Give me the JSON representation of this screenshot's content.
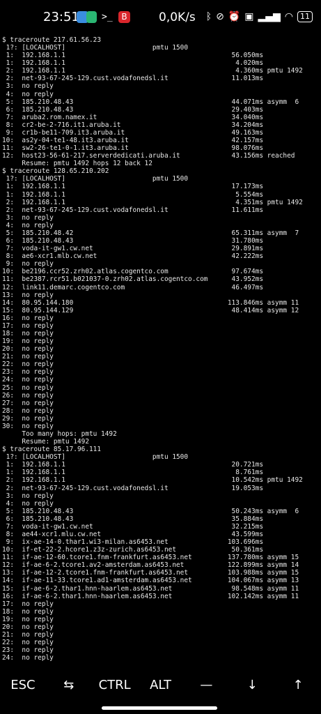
{
  "statusbar": {
    "time": "23:51",
    "net_speed": "0,0K/s",
    "battery": "11",
    "app_icons": [
      "messages-icon",
      "shield-app-icon",
      "terminal-icon",
      "bitwarden-icon"
    ],
    "system_icons": [
      "bluetooth-icon",
      "vibrate-off-icon",
      "alarm-icon",
      "nfc-icon",
      "signal-icon",
      "wifi-icon"
    ]
  },
  "terminal": {
    "lines": [
      "$ traceroute 217.61.56.23",
      " 1?: [LOCALHOST]                      pmtu 1500",
      " 1:  192.168.1.1                                          56.050ms",
      " 1:  192.168.1.1                                           4.020ms",
      " 2:  192.168.1.1                                           4.360ms pmtu 1492",
      " 2:  net-93-67-245-129.cust.vodafonedsl.it                11.013ms",
      " 3:  no reply",
      " 4:  no reply",
      " 5:  185.210.48.43                                        44.071ms asymm  6",
      " 6:  185.210.48.43                                        29.403ms",
      " 7:  aruba2.rom.namex.it                                  34.040ms",
      " 8:  cr2-be-2-716.it1.aruba.it                            34.204ms",
      " 9:  cr1b-be11-709.it3.aruba.it                           49.163ms",
      "10:  as2y-04-te1-48.it3.aruba.it                          42.157ms",
      "11:  sw2-26-te1-0-1.it3.aruba.it                          98.076ms",
      "12:  host23-56-61-217.serverdedicati.aruba.it             43.156ms reached",
      "     Resume: pmtu 1492 hops 12 back 12",
      "$ traceroute 128.65.210.202",
      " 1?: [LOCALHOST]                      pmtu 1500",
      " 1:  192.168.1.1                                          17.173ms",
      " 1:  192.168.1.1                                           5.554ms",
      " 2:  192.168.1.1                                           4.351ms pmtu 1492",
      " 2:  net-93-67-245-129.cust.vodafonedsl.it                11.611ms",
      " 3:  no reply",
      " 4:  no reply",
      " 5:  185.210.48.42                                        65.311ms asymm  7",
      " 6:  185.210.48.43                                        31.780ms",
      " 7:  voda-it-gw1.cw.net                                   29.891ms",
      " 8:  ae6-xcr1.mlb.cw.net                                  42.222ms",
      " 9:  no reply",
      "10:  be2196.ccr52.zrh02.atlas.cogentco.com                97.674ms",
      "11:  be2387.rcr51.b021037-0.zrh02.atlas.cogentco.com      43.952ms",
      "12:  link11.demarc.cogentco.com                           46.497ms",
      "13:  no reply",
      "14:  80.95.144.180                                       113.846ms asymm 11",
      "15:  80.95.144.129                                        48.414ms asymm 12",
      "16:  no reply",
      "17:  no reply",
      "18:  no reply",
      "19:  no reply",
      "20:  no reply",
      "21:  no reply",
      "22:  no reply",
      "23:  no reply",
      "24:  no reply",
      "25:  no reply",
      "26:  no reply",
      "27:  no reply",
      "28:  no reply",
      "29:  no reply",
      "30:  no reply",
      "     Too many hops: pmtu 1492",
      "     Resume: pmtu 1492",
      "$ traceroute 85.17.96.111",
      " 1?: [LOCALHOST]                      pmtu 1500",
      " 1:  192.168.1.1                                          20.721ms",
      " 1:  192.168.1.1                                           8.761ms",
      " 2:  192.168.1.1                                          10.542ms pmtu 1492",
      " 2:  net-93-67-245-129.cust.vodafonedsl.it                19.053ms",
      " 3:  no reply",
      " 4:  no reply",
      " 5:  185.210.48.43                                        50.243ms asymm  6",
      " 6:  185.210.48.43                                        35.884ms",
      " 7:  voda-it-gw1.cw.net                                   32.215ms",
      " 8:  ae44-xcr1.mlu.cw.net                                 43.599ms",
      " 9:  ix-ae-14-0.thar1.wi3-milan.as6453.net               103.696ms",
      "10:  if-et-22-2.hcore1.z3z-zurich.as6453.net              50.361ms",
      "11:  if-ae-12-60.tcore1.fnm-frankfurt.as6453.net         137.780ms asymm 15",
      "12:  if-ae-6-2.tcore1.av2-amsterdam.as6453.net           122.899ms asymm 14",
      "13:  if-ae-12-2.tcore1.fnm-frankfurt.as6453.net          103.988ms asymm 15",
      "14:  if-ae-11-33.tcore1.ad1-amsterdam.as6453.net         104.067ms asymm 13",
      "15:  if-ae-6-2.thar1.hnn-haarlem.as6453.net               98.548ms asymm 11",
      "16:  if-ae-6-2.thar1.hnn-haarlem.as6453.net              102.142ms asymm 11",
      "17:  no reply",
      "18:  no reply",
      "19:  no reply",
      "20:  no reply",
      "21:  no reply",
      "22:  no reply",
      "23:  no reply",
      "24:  no reply"
    ]
  },
  "keybar": {
    "keys": [
      {
        "label": "ESC",
        "name": "esc-key"
      },
      {
        "label": "",
        "name": "tab-key",
        "icon": "tab-arrows-icon"
      },
      {
        "label": "CTRL",
        "name": "ctrl-key"
      },
      {
        "label": "ALT",
        "name": "alt-key"
      },
      {
        "label": "—",
        "name": "dash-key"
      },
      {
        "label": "↓",
        "name": "arrow-down-key"
      },
      {
        "label": "↑",
        "name": "arrow-up-key"
      }
    ]
  }
}
